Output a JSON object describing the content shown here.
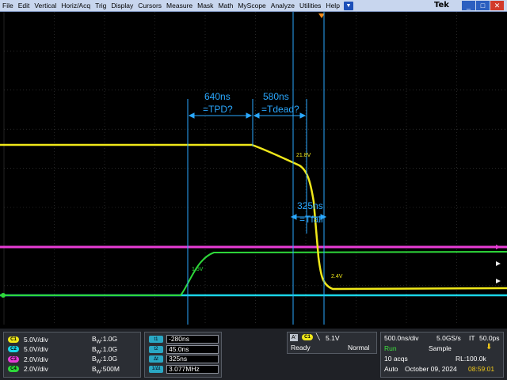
{
  "menu": {
    "items": [
      "File",
      "Edit",
      "Vertical",
      "Horiz/Acq",
      "Trig",
      "Display",
      "Cursors",
      "Measure",
      "Mask",
      "Math",
      "MyScope",
      "Analyze",
      "Utilities",
      "Help"
    ],
    "brand": "Tek"
  },
  "annotations": {
    "tpd_value": "640ns",
    "tpd_label": "=TPD?",
    "tdead_value": "580ns",
    "tdead_label": "=Tdead?",
    "tfall_value": "325ns",
    "tfall_label": "=Tfall",
    "v1": "21.8V",
    "v2": "1.5V",
    "v3": "2.4V"
  },
  "channels": [
    {
      "id": "C1",
      "scale": "5.0V/div",
      "bw": "1.0G",
      "color": "#f0e81a"
    },
    {
      "id": "C2",
      "scale": "5.0V/div",
      "bw": "1.0G",
      "color": "#1ad6e8"
    },
    {
      "id": "C3",
      "scale": "2.0V/div",
      "bw": "1.0G",
      "color": "#e83cd6"
    },
    {
      "id": "C4",
      "scale": "2.0V/div",
      "bw": "500M",
      "color": "#2ed83a"
    }
  ],
  "bw_prefix": "B",
  "bw_sub": "W",
  "cursors": [
    {
      "badge": "t1",
      "value": "-280ns"
    },
    {
      "badge": "t2",
      "value": "45.0ns"
    },
    {
      "badge": "Δt",
      "value": "325ns"
    },
    {
      "badge": "1/Δt",
      "value": "3.077MHz"
    }
  ],
  "trigger": {
    "source_badge": "A'",
    "channel": "C1",
    "level": "5.1V",
    "state": "Ready",
    "mode": "Normal"
  },
  "acq": {
    "timebase": "500.0ns/div",
    "rate": "5.0GS/s",
    "it": "IT",
    "it_val": "50.0ps",
    "run": "Run",
    "mode": "Sample",
    "acqs": "10 acqs",
    "rl": "RL:100.0k",
    "auto": "Auto",
    "date": "October 09, 2024",
    "time": "08:59:01"
  }
}
